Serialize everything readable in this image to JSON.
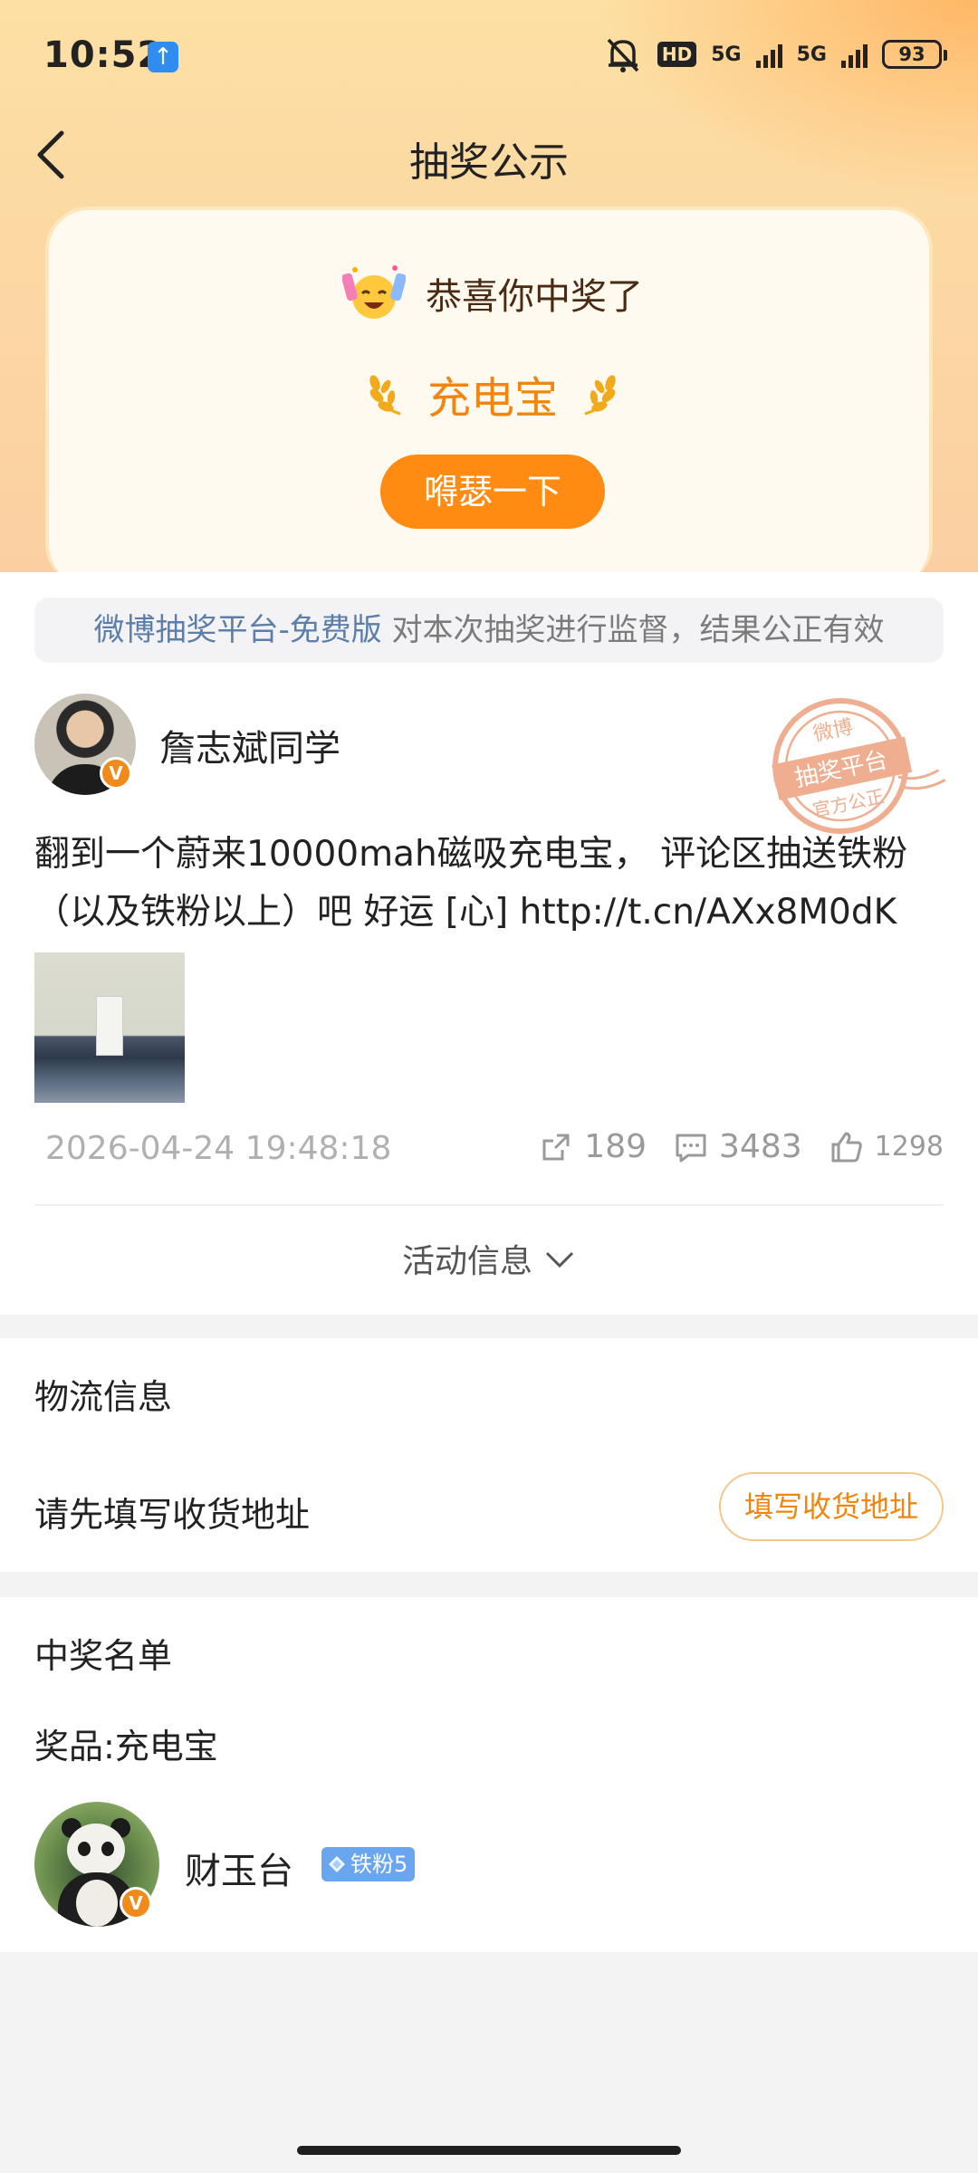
{
  "status_bar": {
    "time": "10:52",
    "network1": "5G",
    "network2": "5G",
    "hd": "HD",
    "battery": "93"
  },
  "nav": {
    "title": "抽奖公示"
  },
  "prize_card": {
    "congrats": "恭喜你中奖了",
    "prize": "充电宝",
    "share_button": "嘚瑟一下"
  },
  "notice": {
    "highlight": "微博抽奖平台-免费版",
    "text": " 对本次抽奖进行监督，结果公正有效"
  },
  "post": {
    "author": "詹志斌同学",
    "stamp": {
      "top": "微博",
      "middle": "抽奖平台",
      "bottom": "官方公正"
    },
    "text": "翻到一个蔚来10000mah磁吸充电宝， 评论区抽送铁粉（以及铁粉以上）吧 好运 [心]  http://t.cn/AXx8M0dK",
    "time": "2026-04-24 19:48:18",
    "reposts": "189",
    "comments": "3483",
    "likes": "1298"
  },
  "activity": {
    "label": "活动信息"
  },
  "logistics": {
    "title": "物流信息",
    "hint": "请先填写收货地址",
    "address_button": "填写收货地址"
  },
  "winners": {
    "title": "中奖名单",
    "prize_line": "奖品:充电宝",
    "list": [
      {
        "name": "财玉台",
        "badge": "铁粉5"
      }
    ]
  },
  "colors": {
    "accent": "#ff8b12",
    "link": "#5b7fa8",
    "fan_badge": "#6aa6f0"
  }
}
